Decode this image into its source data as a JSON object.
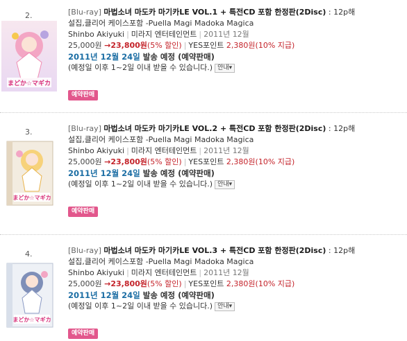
{
  "colors": {
    "sale_red": "#c4232a",
    "date_blue": "#1c6ea4",
    "badge_pink": "#e2578c"
  },
  "items": [
    {
      "number": "2.",
      "category": "[Blu-ray]",
      "title": "마법소녀 마도카 마기카LE VOL.1 + 특전CD 포함 한정판(2Disc)",
      "title_suffix": " : 12p해",
      "title_line2": "설집,클리어 케이스포함 -Puella Magi Madoka Magica",
      "author": "Shinbo Akiyuki",
      "publisher": "미라지 엔터테인먼트",
      "pub_date": "2011년 12월",
      "original_price": "25,000원",
      "arrow": "→",
      "sale_price": "23,800원",
      "discount": "(5% 할인)",
      "points_label": "YES포인트",
      "points_value": "2,380원(10% 지급)",
      "ship_date": "2011년 12월 24일",
      "ship_text": " 발송 예정 (예약판매)",
      "note": "(예정일 이후 1~2일 이내 받을 수 있습니다.)",
      "guide_label": "안내▾",
      "badge": "예약판매",
      "cover_logo": "まどか☆マギカ"
    },
    {
      "number": "3.",
      "category": "[Blu-ray]",
      "title": "마법소녀 마도카 마기카LE VOL.2 + 특전CD 포함 한정판(2Disc)",
      "title_suffix": " : 12p해",
      "title_line2": "설집,클리어 케이스포함 -Puella Magi Madoka Magica",
      "author": "Shinbo Akiyuki",
      "publisher": "미라지 엔터테인먼트",
      "pub_date": "2011년 12월",
      "original_price": "25,000원",
      "arrow": "→",
      "sale_price": "23,800원",
      "discount": "(5% 할인)",
      "points_label": "YES포인트",
      "points_value": "2,380원(10% 지급)",
      "ship_date": "2011년 12월 24일",
      "ship_text": " 발송 예정 (예약판매)",
      "note": "(예정일 이후 1~2일 이내 받을 수 있습니다.)",
      "guide_label": "안내▾",
      "badge": "예약판매",
      "cover_logo": "まどか☆マギカ"
    },
    {
      "number": "4.",
      "category": "[Blu-ray]",
      "title": "마법소녀 마도카 마기카LE VOL.3 + 특전CD 포함 한정판(2Disc)",
      "title_suffix": " : 12p해",
      "title_line2": "설집,클리어 케이스포함 -Puella Magi Madoka Magica",
      "author": "Shinbo Akiyuki",
      "publisher": "미라지 엔터테인먼트",
      "pub_date": "2011년 12월",
      "original_price": "25,000원",
      "arrow": "→",
      "sale_price": "23,800원",
      "discount": "(5% 할인)",
      "points_label": "YES포인트",
      "points_value": "2,380원(10% 지급)",
      "ship_date": "2011년 12월 24일",
      "ship_text": " 발송 예정 (예약판매)",
      "note": "(예정일 이후 1~2일 이내 받을 수 있습니다.)",
      "guide_label": "안내▾",
      "badge": "예약판매",
      "cover_logo": "まどか☆マギカ"
    }
  ]
}
